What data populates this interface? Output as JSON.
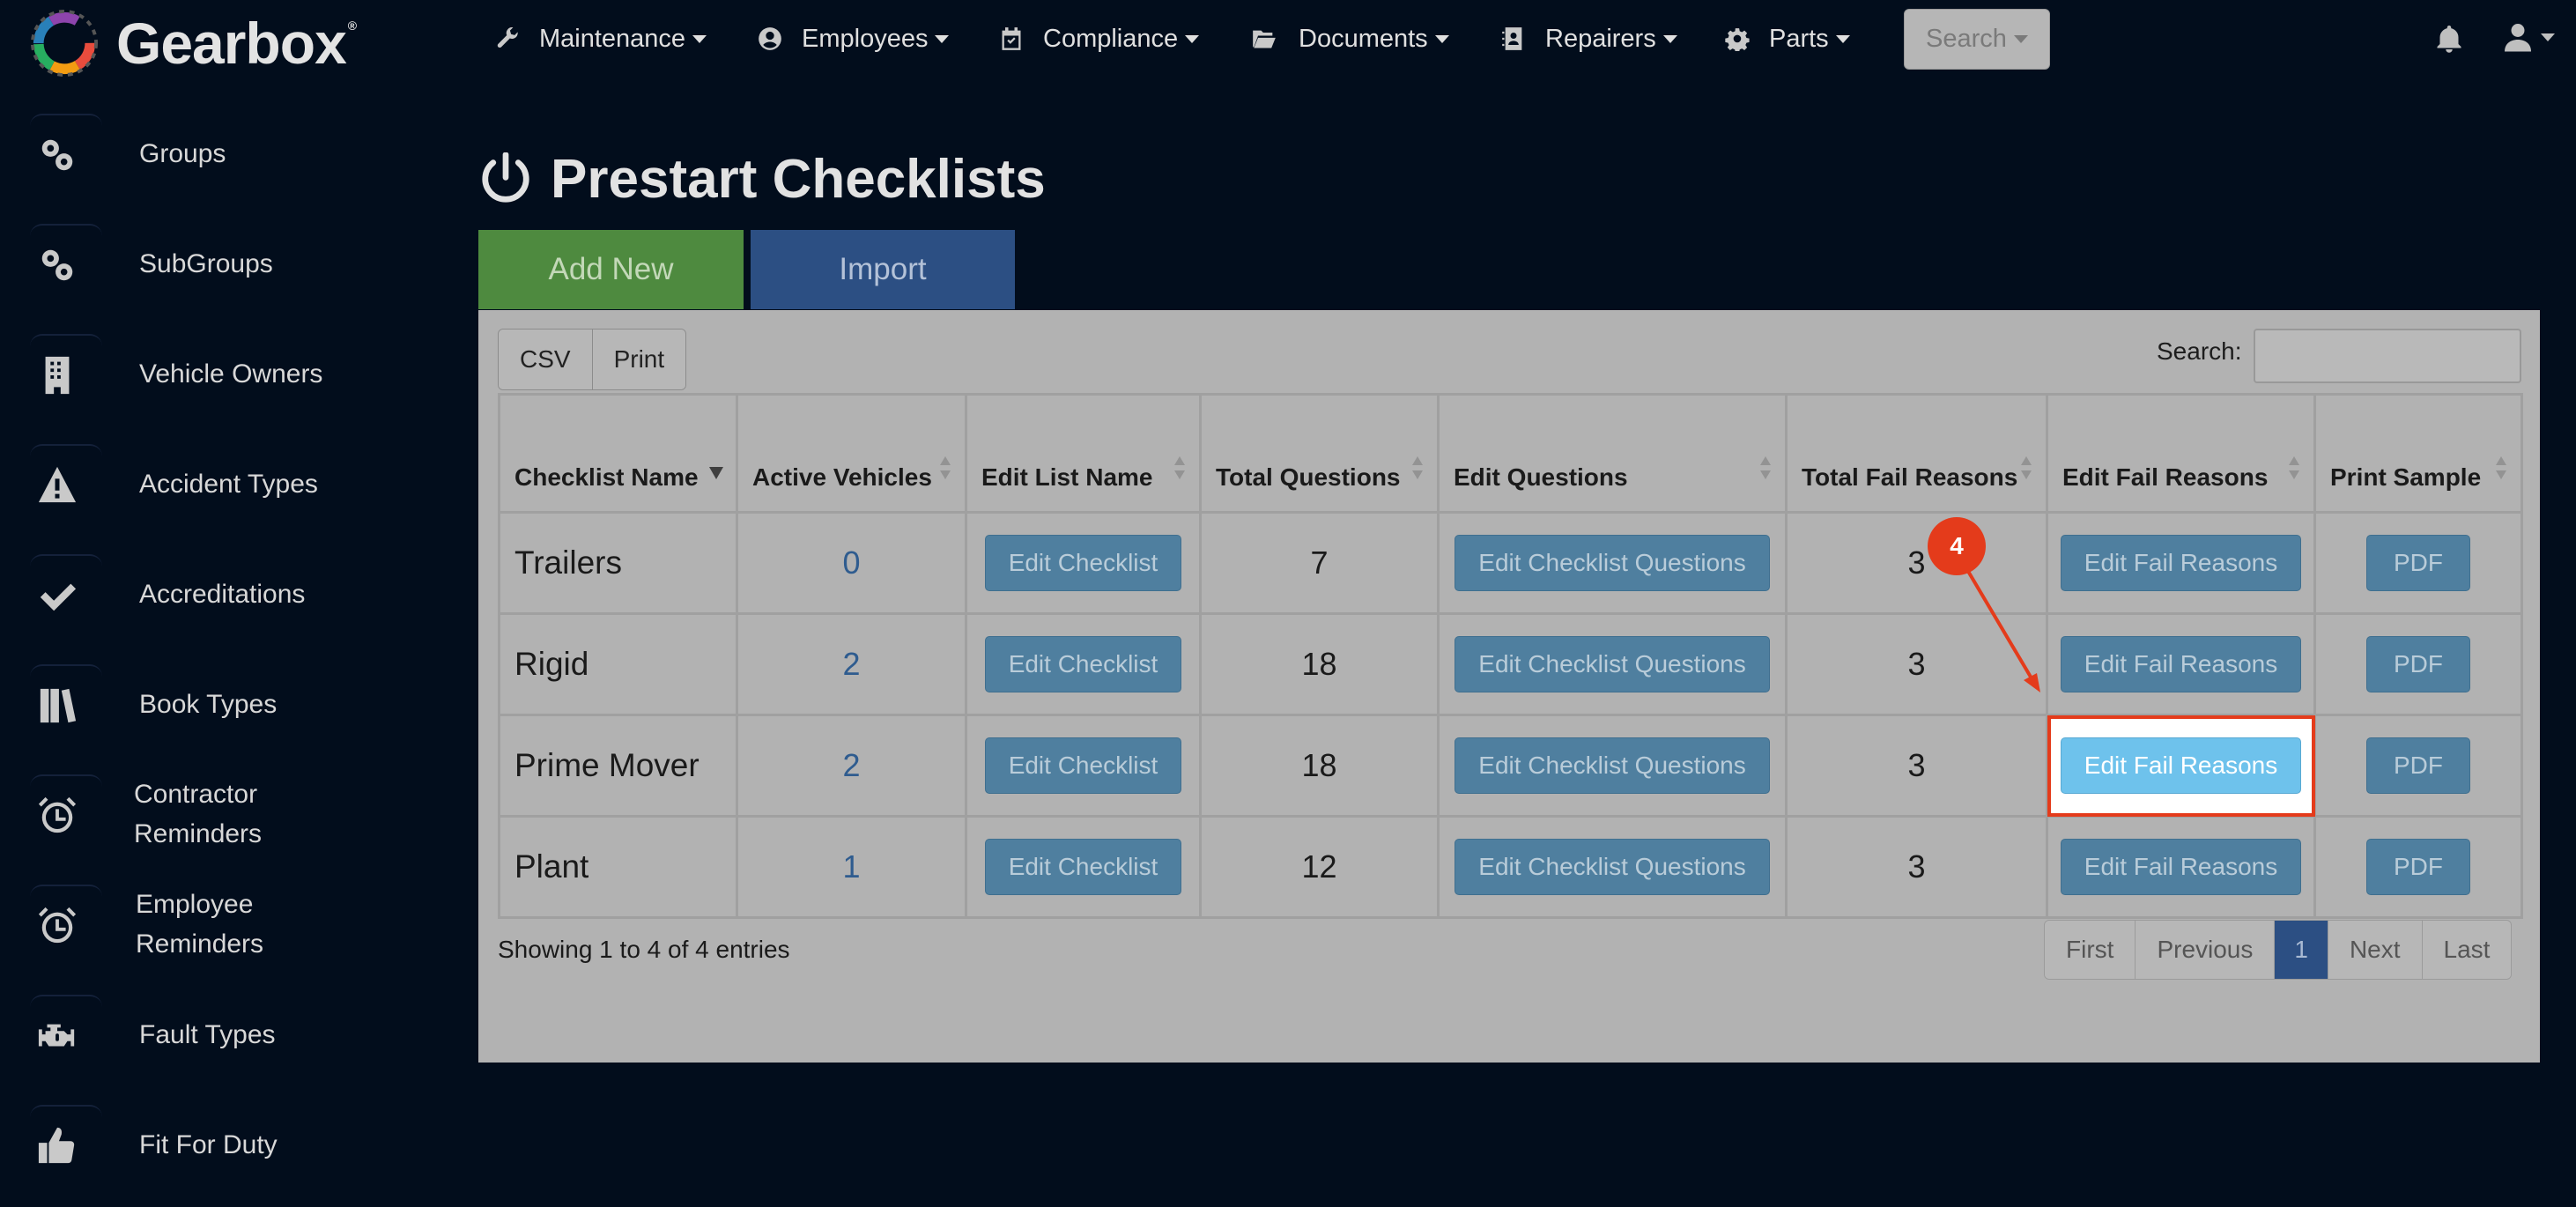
{
  "app": {
    "name": "Gearbox",
    "trademark": "®"
  },
  "nav": {
    "items": [
      {
        "label": "Maintenance",
        "icon": "wrench-icon"
      },
      {
        "label": "Employees",
        "icon": "user-circle-icon"
      },
      {
        "label": "Compliance",
        "icon": "calendar-check-icon"
      },
      {
        "label": "Documents",
        "icon": "folder-open-icon"
      },
      {
        "label": "Repairers",
        "icon": "address-book-icon"
      },
      {
        "label": "Parts",
        "icon": "gear-icon"
      }
    ],
    "search_label": "Search"
  },
  "sidebar": {
    "items": [
      {
        "label": "Groups",
        "icon": "gears-icon"
      },
      {
        "label": "SubGroups",
        "icon": "gears-icon"
      },
      {
        "label": "Vehicle Owners",
        "icon": "building-icon"
      },
      {
        "label": "Accident Types",
        "icon": "warning-icon"
      },
      {
        "label": "Accreditations",
        "icon": "check-icon"
      },
      {
        "label": "Book Types",
        "icon": "books-icon"
      },
      {
        "label": "Contractor\nReminders",
        "icon": "alarm-clock-icon"
      },
      {
        "label": "Employee\nReminders",
        "icon": "alarm-clock-icon"
      },
      {
        "label": "Fault Types",
        "icon": "engine-icon"
      },
      {
        "label": "Fit For Duty",
        "icon": "thumbs-up-icon"
      }
    ]
  },
  "page": {
    "title": "Prestart Checklists",
    "add_new_label": "Add New",
    "import_label": "Import",
    "csv_label": "CSV",
    "print_label": "Print",
    "search_label": "Search:",
    "search_value": ""
  },
  "table": {
    "columns": [
      "Checklist Name",
      "Active Vehicles",
      "Edit List Name",
      "Total Questions",
      "Edit Questions",
      "Total Fail Reasons",
      "Edit Fail Reasons",
      "Print Sample"
    ],
    "rows": [
      {
        "name": "Trailers",
        "active_vehicles": "0",
        "edit_list": "Edit Checklist",
        "total_questions": "7",
        "edit_questions": "Edit Checklist Questions",
        "total_fail_reasons": "3",
        "edit_fail_reasons": "Edit Fail Reasons",
        "print_sample": "PDF"
      },
      {
        "name": "Rigid",
        "active_vehicles": "2",
        "edit_list": "Edit Checklist",
        "total_questions": "18",
        "edit_questions": "Edit Checklist Questions",
        "total_fail_reasons": "3",
        "edit_fail_reasons": "Edit Fail Reasons",
        "print_sample": "PDF"
      },
      {
        "name": "Prime Mover",
        "active_vehicles": "2",
        "edit_list": "Edit Checklist",
        "total_questions": "18",
        "edit_questions": "Edit Checklist Questions",
        "total_fail_reasons": "3",
        "edit_fail_reasons": "Edit Fail Reasons",
        "print_sample": "PDF"
      },
      {
        "name": "Plant",
        "active_vehicles": "1",
        "edit_list": "Edit Checklist",
        "total_questions": "12",
        "edit_questions": "Edit Checklist Questions",
        "total_fail_reasons": "3",
        "edit_fail_reasons": "Edit Fail Reasons",
        "print_sample": "PDF"
      }
    ],
    "info": "Showing 1 to 4 of 4 entries"
  },
  "pagination": {
    "first": "First",
    "previous": "Previous",
    "current": "1",
    "next": "Next",
    "last": "Last"
  },
  "annotation": {
    "step": "4",
    "highlighted_row": 2,
    "color": "#e43b1b"
  },
  "colors": {
    "background": "#020d1c",
    "add_new": "#4e8a3f",
    "import": "#2c4f83",
    "table_button": "#4f7f9f",
    "active_button": "#6ec2ec"
  }
}
